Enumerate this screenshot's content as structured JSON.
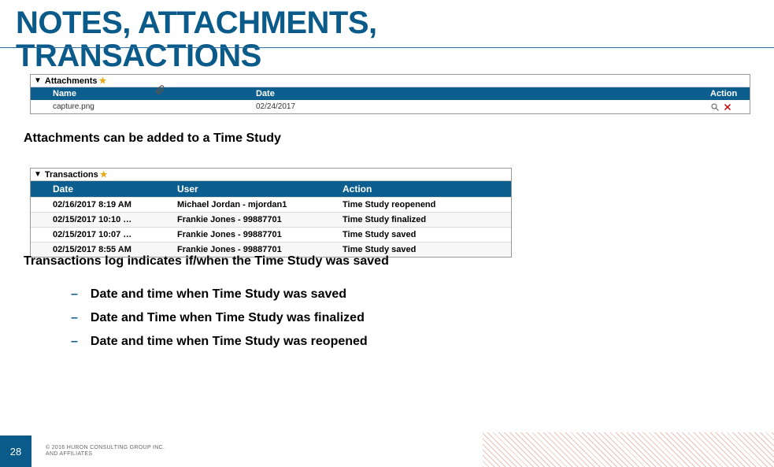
{
  "title": {
    "line1": "NOTES, ATTACHMENTS,",
    "line2": "TRANSACTIONS"
  },
  "attachments": {
    "panel_label": "Attachments",
    "cols": {
      "name": "Name",
      "date": "Date",
      "action": "Action"
    },
    "rows": [
      {
        "name": "capture.png",
        "date": "02/24/2017"
      }
    ]
  },
  "body": {
    "attach_note": "Attachments can be added to a Time Study",
    "trans_note": "Transactions log indicates if/when the Time Study was saved",
    "bullets": [
      "Date and time when Time Study was saved",
      "Date and Time when Time Study was finalized",
      "Date and time when Time Study was reopened"
    ]
  },
  "transactions": {
    "panel_label": "Transactions",
    "cols": {
      "date": "Date",
      "user": "User",
      "action": "Action"
    },
    "rows": [
      {
        "date": "02/16/2017 8:19 AM",
        "user": "Michael Jordan - mjordan1",
        "action": "Time Study reopenend"
      },
      {
        "date": "02/15/2017 10:10 …",
        "user": "Frankie Jones - 99887701",
        "action": "Time Study finalized"
      },
      {
        "date": "02/15/2017 10:07 …",
        "user": "Frankie Jones - 99887701",
        "action": "Time Study saved"
      },
      {
        "date": "02/15/2017 8:55 AM",
        "user": "Frankie Jones - 99887701",
        "action": "Time Study saved"
      }
    ]
  },
  "footer": {
    "page": "28",
    "copyright_l1": "© 2016 HURON CONSULTING GROUP INC.",
    "copyright_l2": "AND AFFILIATES"
  }
}
